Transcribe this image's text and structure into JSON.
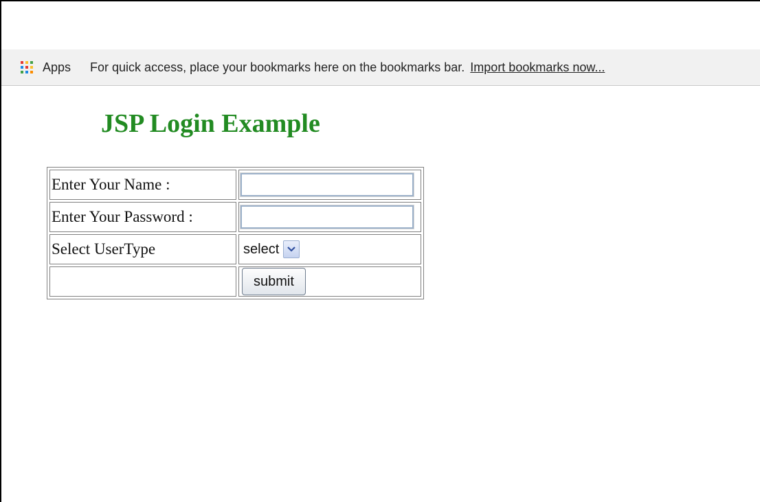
{
  "bookmarks_bar": {
    "apps_icon": "apps-grid-icon",
    "apps_label": "Apps",
    "hint": "For quick access, place your bookmarks here on the bookmarks bar.",
    "import_link": "Import bookmarks now..."
  },
  "page": {
    "title": "JSP Login Example",
    "title_color": "#228b22"
  },
  "form": {
    "name_label": "Enter Your Name :",
    "name_value": "",
    "password_label": "Enter Your Password :",
    "password_value": "",
    "usertype_label": "Select UserType",
    "usertype_selected": "select",
    "usertype_icon": "chevron-down-icon",
    "submit_label": "submit"
  }
}
